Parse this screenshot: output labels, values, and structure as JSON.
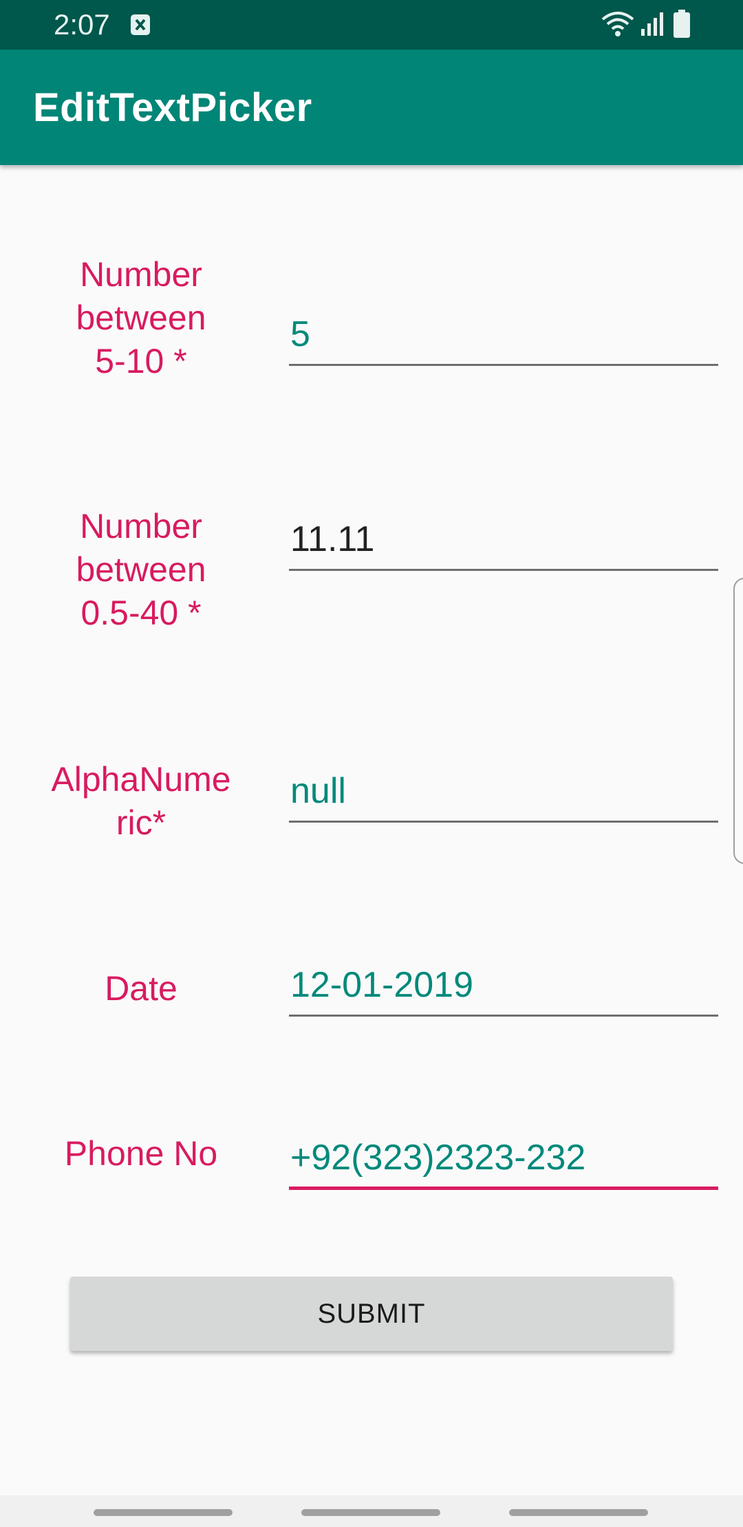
{
  "status_bar": {
    "time": "2:07",
    "icons": [
      "notification-icon",
      "wifi-icon",
      "signal-icon",
      "battery-icon"
    ]
  },
  "app_bar": {
    "title": "EditTextPicker"
  },
  "fields": [
    {
      "label": "Number\nbetween\n5-10 *",
      "value": "5"
    },
    {
      "label": "Number\nbetween\n0.5-40 *",
      "value": "11.11"
    },
    {
      "label": "AlphaNume\nric*",
      "value": "null"
    },
    {
      "label": "Date",
      "value": "12-01-2019"
    },
    {
      "label": "Phone No",
      "value": "+92(323)2323-232"
    }
  ],
  "submit": {
    "label": "SUBMIT"
  },
  "colors": {
    "status_bar": "#00574b",
    "app_bar": "#008577",
    "label": "#d81b60",
    "value_teal": "#00897b",
    "accent": "#d81b60"
  }
}
